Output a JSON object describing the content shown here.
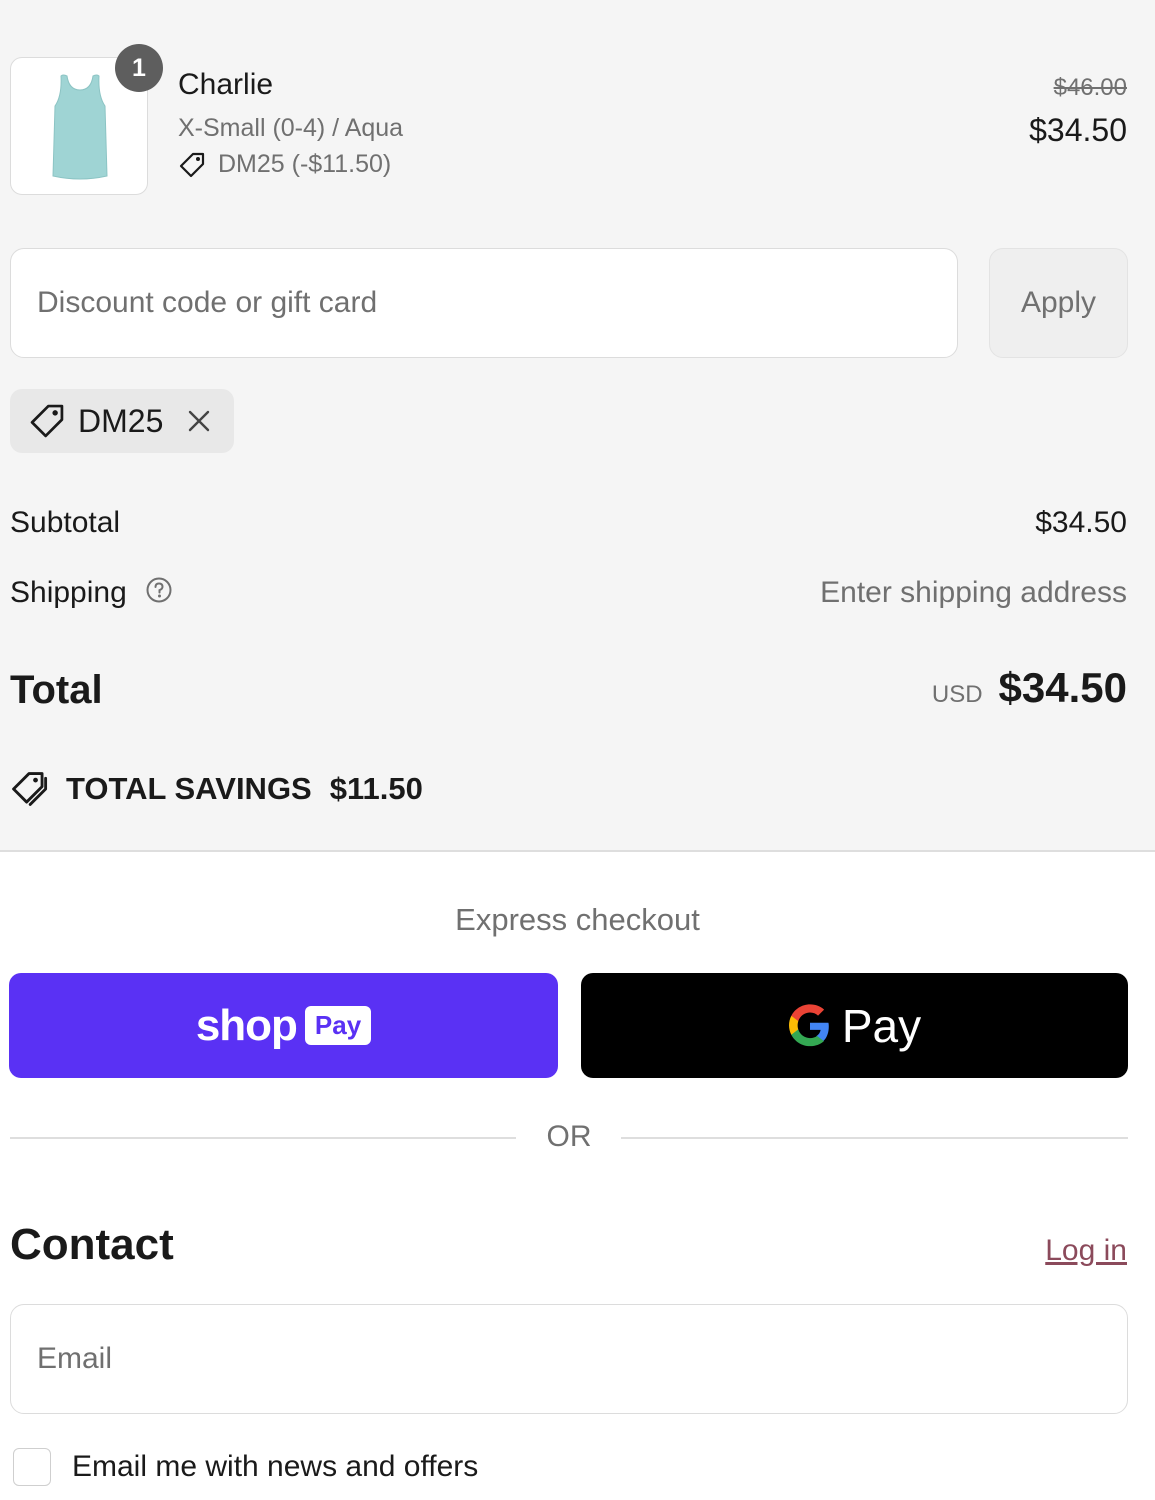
{
  "product": {
    "name": "Charlie",
    "quantity": "1",
    "variant": "X-Small (0-4) / Aqua",
    "discount_line": "DM25 (-$11.50)",
    "compare_price": "$46.00",
    "price": "$34.50",
    "image_color": "#9fd4d4",
    "icon": "tag-icon"
  },
  "discount": {
    "placeholder": "Discount code or gift card",
    "apply_label": "Apply",
    "applied_code": "DM25"
  },
  "summary": {
    "subtotal_label": "Subtotal",
    "subtotal_value": "$34.50",
    "shipping_label": "Shipping",
    "shipping_value": "Enter shipping address",
    "total_label": "Total",
    "currency": "USD",
    "total_value": "$34.50",
    "savings_label": "TOTAL SAVINGS",
    "savings_value": "$11.50"
  },
  "express": {
    "title": "Express checkout",
    "shop_word": "shop",
    "shop_pay_badge": "Pay",
    "gpay_word": "Pay",
    "shop_color": "#5a31f4",
    "or_text": "OR"
  },
  "contact": {
    "title": "Contact",
    "login_label": "Log in",
    "email_placeholder": "Email",
    "newsletter_label": "Email me with news and offers",
    "link_color": "#8b4a5b"
  }
}
